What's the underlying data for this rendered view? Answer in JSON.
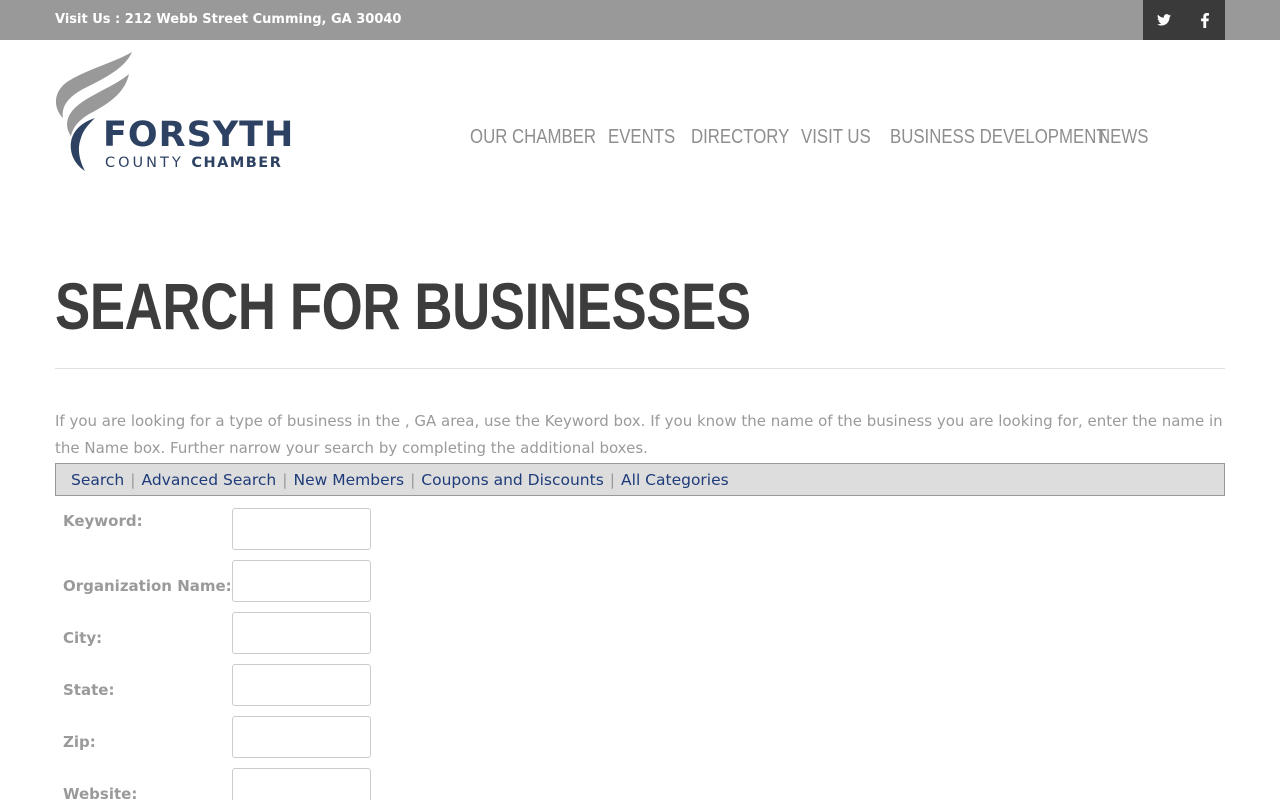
{
  "topbar": {
    "visit_text": "Visit Us : 212 Webb Street Cumming, GA 30040",
    "social": [
      {
        "icon": "twitter-icon"
      },
      {
        "icon": "facebook-icon"
      }
    ],
    "background": "#999999",
    "social_background": "#3a3a3a"
  },
  "logo": {
    "word1": "FORSYTH",
    "word2_light": "COUNTY",
    "word2_bold": "CHAMBER",
    "brand_color": "#2d4262",
    "flame_colors": [
      "#999999",
      "#2d4262"
    ]
  },
  "nav": {
    "items": [
      "OUR CHAMBER",
      "EVENTS",
      "DIRECTORY",
      "VISIT US",
      "BUSINESS DEVELOPMENT",
      "NEWS"
    ]
  },
  "page": {
    "title": "SEARCH FOR BUSINESSES",
    "intro": "If you are looking for a type of business in the , GA area, use the Keyword box. If you know the name of the business you are looking for, enter the name in the Name box. Further narrow your search by completing the additional boxes."
  },
  "subnav": {
    "links": [
      "Search",
      "Advanced Search",
      "New Members",
      "Coupons and Discounts",
      "All Categories"
    ],
    "separator": "|",
    "link_color": "#1e3c7a"
  },
  "form": {
    "fields": [
      {
        "label": "Keyword:",
        "value": ""
      },
      {
        "label": "Organization Name:",
        "value": ""
      },
      {
        "label": "City:",
        "value": ""
      },
      {
        "label": "State:",
        "value": ""
      },
      {
        "label": "Zip:",
        "value": ""
      },
      {
        "label": "Website:",
        "value": ""
      }
    ]
  }
}
